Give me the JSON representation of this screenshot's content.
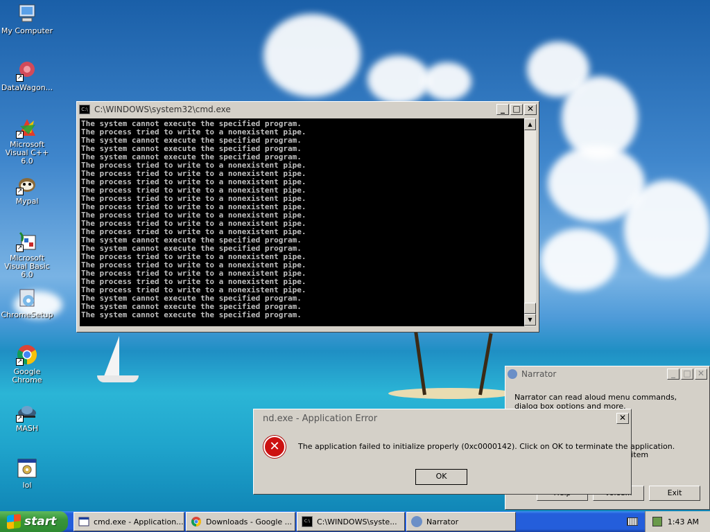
{
  "desktop": {
    "icons": [
      {
        "label": "My Computer",
        "icon": "computer-icon"
      },
      {
        "label": "DataWagon...",
        "icon": "datawagon-icon"
      },
      {
        "label": "Microsoft Visual C++ 6.0",
        "icon": "visual-cpp-icon"
      },
      {
        "label": "Mypal",
        "icon": "mypal-icon"
      },
      {
        "label": "Microsoft Visual Basic 6.0",
        "icon": "visual-basic-icon"
      },
      {
        "label": "ChromeSetup",
        "icon": "chrome-setup-icon"
      },
      {
        "label": "Google Chrome",
        "icon": "chrome-icon"
      },
      {
        "label": "MASH",
        "icon": "mash-icon"
      },
      {
        "label": "lol",
        "icon": "batch-file-icon"
      }
    ]
  },
  "cmd_window": {
    "title": "C:\\WINDOWS\\system32\\cmd.exe",
    "lines": [
      "The system cannot execute the specified program.",
      "The process tried to write to a nonexistent pipe.",
      "The system cannot execute the specified program.",
      "The system cannot execute the specified program.",
      "The system cannot execute the specified program.",
      "The process tried to write to a nonexistent pipe.",
      "The process tried to write to a nonexistent pipe.",
      "The process tried to write to a nonexistent pipe.",
      "The process tried to write to a nonexistent pipe.",
      "The process tried to write to a nonexistent pipe.",
      "The process tried to write to a nonexistent pipe.",
      "The process tried to write to a nonexistent pipe.",
      "The process tried to write to a nonexistent pipe.",
      "The process tried to write to a nonexistent pipe.",
      "The system cannot execute the specified program.",
      "The system cannot execute the specified program.",
      "The process tried to write to a nonexistent pipe.",
      "The process tried to write to a nonexistent pipe.",
      "The process tried to write to a nonexistent pipe.",
      "The process tried to write to a nonexistent pipe.",
      "The process tried to write to a nonexistent pipe.",
      "The system cannot execute the specified program.",
      "The system cannot execute the specified program.",
      "The system cannot execute the specified program."
    ]
  },
  "narrator": {
    "title": "Narrator",
    "text": "Narrator can read aloud menu commands, dialog box options and more.",
    "partial_text": "e item",
    "help_label": "Help",
    "voice_label": "Voice...",
    "exit_label": "Exit"
  },
  "error_dialog": {
    "title": "nd.exe - Application Error",
    "message": "The application failed to initialize properly (0xc0000142). Click on OK to terminate the application.",
    "ok_label": "OK"
  },
  "taskbar": {
    "start_label": "start",
    "items": [
      {
        "label": "cmd.exe - Application...",
        "icon": "window-icon"
      },
      {
        "label": "Downloads - Google ...",
        "icon": "chrome-icon"
      },
      {
        "label": "C:\\WINDOWS\\syste...",
        "icon": "cmd-icon"
      },
      {
        "label": "Narrator",
        "icon": "narrator-icon"
      }
    ],
    "clock": "1:43 AM"
  },
  "colors": {
    "error_red": "#cc1111",
    "console_bg": "#000000",
    "console_text": "#c0c0c0",
    "taskbar_blue": "#245edb",
    "start_green": "#38953a"
  }
}
